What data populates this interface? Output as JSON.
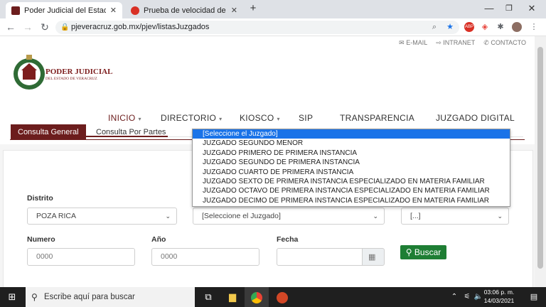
{
  "browser": {
    "tabs": [
      {
        "title": "Poder Judicial del Estado de Vera",
        "active": true
      },
      {
        "title": "Prueba de velocidad de Internet",
        "active": false
      }
    ],
    "new_tab": "+",
    "window_controls": {
      "minimize": "—",
      "maximize": "❐",
      "close": "✕"
    },
    "url": "pjeveracruz.gob.mx/pjev/listasJuzgados",
    "extension_badge": "ABP"
  },
  "page": {
    "top_links": [
      "E-MAIL",
      "INTRANET",
      "CONTACTO"
    ],
    "logo": {
      "title": "PODER JUDICIAL",
      "subtitle": "DEL ESTADO DE VERACRUZ"
    },
    "nav": [
      {
        "label": "INICIO",
        "chevron": true
      },
      {
        "label": "DIRECTORIO",
        "chevron": true
      },
      {
        "label": "KIOSCO",
        "chevron": true
      },
      {
        "label": "SIP",
        "chevron": false
      },
      {
        "label": "TRANSPARENCIA",
        "chevron": false
      },
      {
        "label": "JUZGADO DIGITAL",
        "chevron": false
      }
    ],
    "tabs": [
      "Consulta General",
      "Consulta Por Partes"
    ],
    "form": {
      "distrito_label": "Distrito",
      "distrito_value": "POZA RICA",
      "juzgado_value": "[Seleccione el Juzgado]",
      "third_value": "[...]",
      "numero_label": "Numero",
      "numero_placeholder": "0000",
      "anio_label": "Año",
      "anio_placeholder": "0000",
      "fecha_label": "Fecha",
      "buscar_label": "Buscar"
    },
    "dropdown_options": [
      "[Seleccione el Juzgado]",
      "JUZGADO SEGUNDO MENOR",
      "JUZGADO PRIMERO DE PRIMERA INSTANCIA",
      "JUZGADO SEGUNDO DE PRIMERA INSTANCIA",
      "JUZGADO CUARTO DE PRIMERA INSTANCIA",
      "JUZGADO SEXTO DE PRIMERA INSTANCIA ESPECIALIZADO EN MATERIA FAMILIAR",
      "JUZGADO OCTAVO DE PRIMERA INSTANCIA ESPECIALIZADO EN MATERIA FAMILIAR",
      "JUZGADO DECIMO DE PRIMERA INSTANCIA ESPECIALIZADO EN MATERIA FAMILIAR"
    ]
  },
  "taskbar": {
    "search_placeholder": "Escribe aquí para buscar",
    "time": "03:06 p. m.",
    "date": "14/03/2021"
  },
  "colors": {
    "brand": "#6c1d1d",
    "button_green": "#1e7e34",
    "highlight": "#1a73e8"
  }
}
